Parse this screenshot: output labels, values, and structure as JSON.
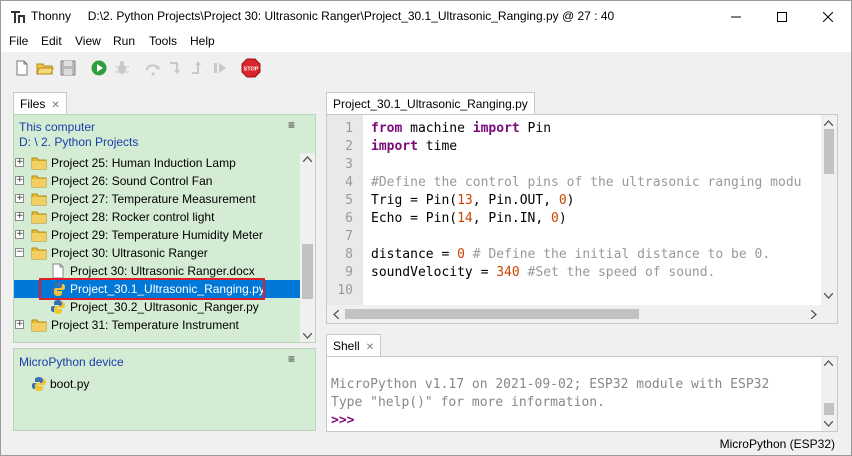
{
  "window": {
    "app_name": "Thonny",
    "title_path": "D:\\2. Python Projects\\Project 30:  Ultrasonic Ranger\\Project_30.1_Ultrasonic_Ranging.py  @  27 : 40"
  },
  "menu": [
    "File",
    "Edit",
    "View",
    "Run",
    "Tools",
    "Help"
  ],
  "toolbar": {
    "icons": [
      "new-file-icon",
      "open-folder-icon",
      "save-icon",
      "run-icon",
      "debug-icon",
      "step-over-icon",
      "step-into-icon",
      "step-out-icon",
      "resume-icon",
      "stop-icon"
    ],
    "stop_label": "STOP"
  },
  "files": {
    "tab_label": "Files",
    "this_computer": "This computer",
    "path": "D: \\ 2. Python Projects",
    "menu_glyph": "≡",
    "items": [
      {
        "label": "Project 25:  Human  Induction Lamp",
        "type": "folder",
        "expander": "+"
      },
      {
        "label": "Project 26:  Sound Control Fan",
        "type": "folder",
        "expander": "+"
      },
      {
        "label": "Project 27:  Temperature Measurement",
        "type": "folder",
        "expander": "+"
      },
      {
        "label": "Project 28:  Rocker control light",
        "type": "folder",
        "expander": "+"
      },
      {
        "label": "Project 29:  Temperature Humidity Meter",
        "type": "folder",
        "expander": "+"
      },
      {
        "label": "Project 30:  Ultrasonic Ranger",
        "type": "folder",
        "expander": "−"
      },
      {
        "label": "Project 30:  Ultrasonic Ranger.docx",
        "type": "doc",
        "expander": ""
      },
      {
        "label": "Project_30.1_Ultrasonic_Ranging.py",
        "type": "python",
        "expander": ""
      },
      {
        "label": "Project_30.2_Ultrasonic_Ranger.py",
        "type": "python",
        "expander": ""
      },
      {
        "label": "Project 31:  Temperature Instrument",
        "type": "folder",
        "expander": "+"
      }
    ],
    "device_title": "MicroPython device",
    "device_menu_glyph": "≡",
    "device_items": [
      {
        "label": "boot.py",
        "type": "python"
      }
    ]
  },
  "editor": {
    "tab_label": "Project_30.1_Ultrasonic_Ranging.py",
    "line_numbers": [
      "1",
      "2",
      "3",
      "4",
      "5",
      "6",
      "7",
      "8",
      "9",
      "10"
    ],
    "lines": [
      [
        {
          "t": "from",
          "c": "kw"
        },
        {
          "t": " machine ",
          "c": ""
        },
        {
          "t": "import",
          "c": "kw"
        },
        {
          "t": " Pin",
          "c": ""
        }
      ],
      [
        {
          "t": "import",
          "c": "kw"
        },
        {
          "t": " time",
          "c": ""
        }
      ],
      [],
      [
        {
          "t": "#Define the control pins of the ultrasonic ranging modu",
          "c": "cm"
        }
      ],
      [
        {
          "t": "Trig = Pin(",
          "c": ""
        },
        {
          "t": "13",
          "c": "num"
        },
        {
          "t": ", Pin.OUT, ",
          "c": ""
        },
        {
          "t": "0",
          "c": "num"
        },
        {
          "t": ")",
          "c": ""
        }
      ],
      [
        {
          "t": "Echo = Pin(",
          "c": ""
        },
        {
          "t": "14",
          "c": "num"
        },
        {
          "t": ", Pin.IN, ",
          "c": ""
        },
        {
          "t": "0",
          "c": "num"
        },
        {
          "t": ")",
          "c": ""
        }
      ],
      [],
      [
        {
          "t": "distance = ",
          "c": ""
        },
        {
          "t": "0",
          "c": "num"
        },
        {
          "t": " # Define the initial distance to be 0.",
          "c": "cm"
        }
      ],
      [
        {
          "t": "soundVelocity = ",
          "c": ""
        },
        {
          "t": "340",
          "c": "num"
        },
        {
          "t": " #Set the speed of sound.",
          "c": "cm"
        }
      ],
      []
    ]
  },
  "shell": {
    "tab_label": "Shell",
    "lines": [
      "MicroPython v1.17 on 2021-09-02; ESP32 module with ESP32",
      "Type \"help()\" for more information."
    ],
    "prompt": ">>>"
  },
  "status": {
    "interpreter": "MicroPython (ESP32)"
  },
  "colors": {
    "panel_green": "#d4ecd4",
    "selection": "#0078d7",
    "highlight_border": "#e0202a",
    "keyword": "#7a0a7a",
    "number": "#cc4400",
    "comment": "#999999",
    "link_blue": "#1a3ea8"
  }
}
